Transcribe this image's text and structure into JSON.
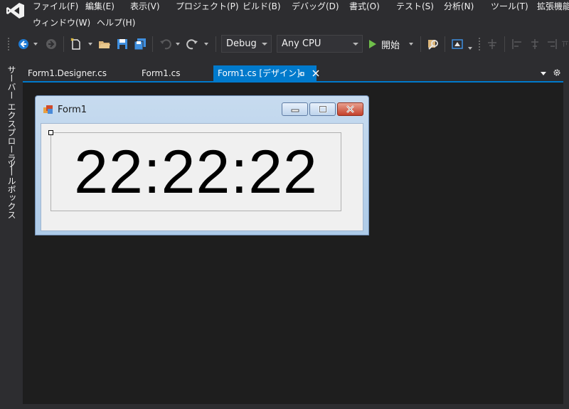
{
  "menubar": {
    "row1": [
      {
        "label": "ファイル(F)"
      },
      {
        "label": "編集(E)"
      },
      {
        "label": "表示(V)"
      },
      {
        "label": "プロジェクト(P)"
      },
      {
        "label": "ビルド(B)"
      },
      {
        "label": "デバッグ(D)"
      },
      {
        "label": "書式(O)"
      },
      {
        "label": "テスト(S)"
      },
      {
        "label": "分析(N)"
      },
      {
        "label": "ツール(T)"
      },
      {
        "label": "拡張機能"
      }
    ],
    "row2": [
      {
        "label": "ウィンドウ(W)"
      },
      {
        "label": "ヘルプ(H)"
      }
    ]
  },
  "toolbar": {
    "configuration": "Debug",
    "platform": "Any CPU",
    "start_label": "開始"
  },
  "left_rail": {
    "server_explorer": "サーバー エクスプローラー",
    "toolbox": "ツールボックス"
  },
  "tabs": [
    {
      "label": "Form1.Designer.cs"
    },
    {
      "label": "Form1.cs"
    },
    {
      "label": "Form1.cs [デザイン]"
    }
  ],
  "form": {
    "title": "Form1",
    "clock_text": "22:22:22"
  },
  "colors": {
    "accent": "#007acc",
    "ide_background": "#2d2d30",
    "designer_background": "#1e1e1e",
    "form_background": "#f0f0f0"
  },
  "icons": [
    "visual-studio-logo-icon",
    "back-icon",
    "forward-icon",
    "new-project-icon",
    "open-icon",
    "save-icon",
    "save-all-icon",
    "undo-icon",
    "redo-icon",
    "start-play-icon",
    "find-icon",
    "snapshot-icon",
    "align-icon",
    "pin-icon",
    "close-icon",
    "settings-gear-icon"
  ]
}
